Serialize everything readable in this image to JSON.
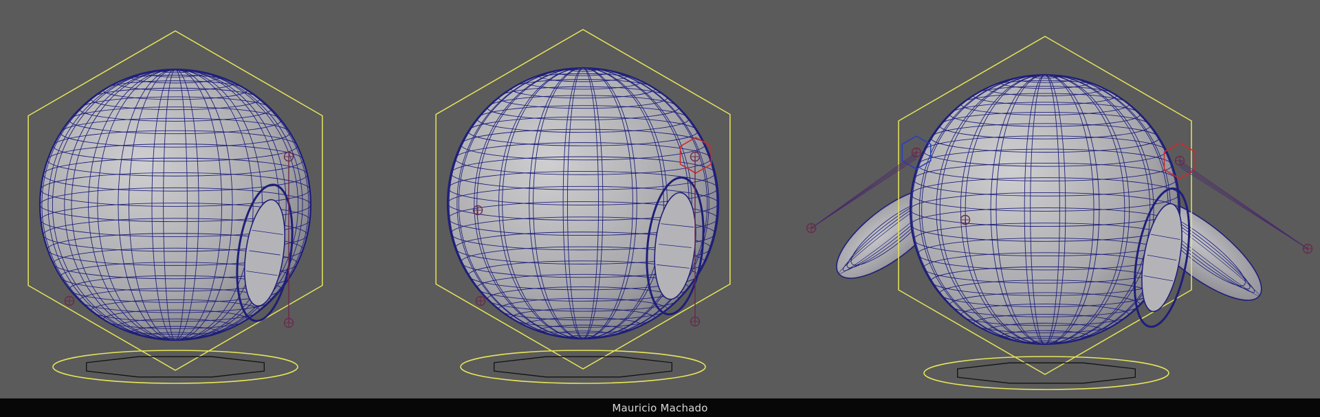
{
  "footer": {
    "credit": "Mauricio Machado"
  },
  "colors": {
    "background": "#5b5b5b",
    "wire": "#1e1e7a",
    "selection": "#e8e65a",
    "control_red": "#cf2a2a",
    "control_blue": "#2a3fbf",
    "joint": "#6a2a4a"
  },
  "scene": {
    "views": [
      {
        "name": "sphere-front-left",
        "has_wings": false
      },
      {
        "name": "sphere-three-quarter",
        "has_wings": false
      },
      {
        "name": "sphere-with-wings",
        "has_wings": true
      }
    ]
  }
}
